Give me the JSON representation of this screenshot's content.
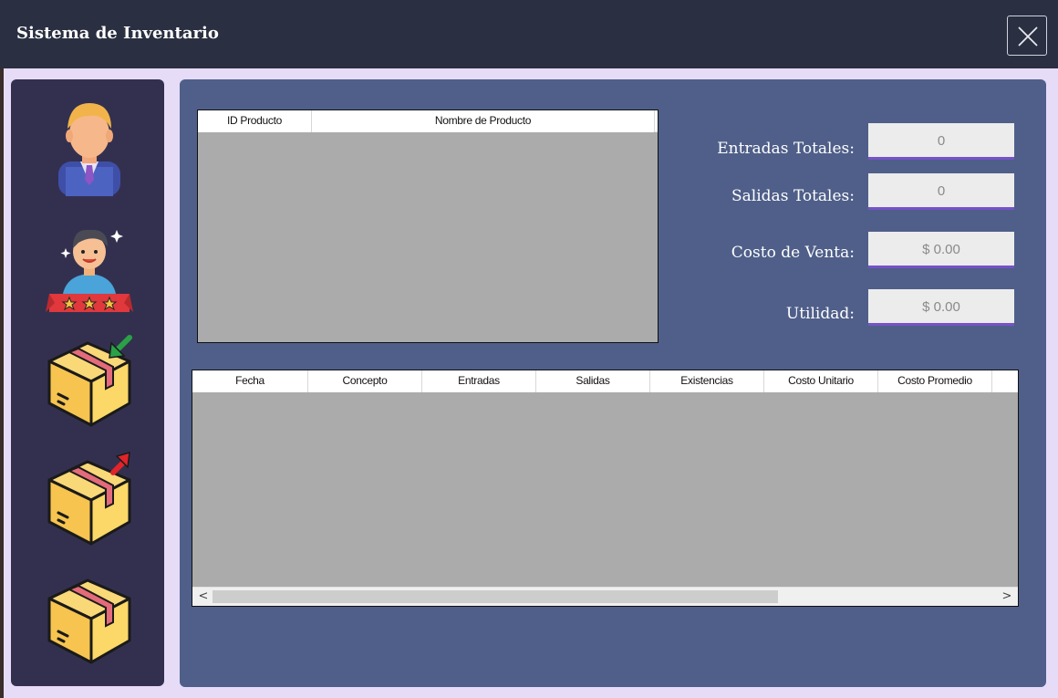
{
  "window": {
    "title": "Sistema de Inventario",
    "close_glyph": "✕"
  },
  "sidebar": {
    "items": [
      {
        "name": "user-avatar-icon"
      },
      {
        "name": "customer-rating-icon"
      },
      {
        "name": "box-inbound-icon"
      },
      {
        "name": "box-outbound-icon"
      },
      {
        "name": "box-inventory-icon"
      }
    ]
  },
  "products_table": {
    "columns": [
      "ID Producto",
      "Nombre de Producto"
    ],
    "rows": []
  },
  "summary": {
    "entradas_label": "Entradas Totales:",
    "entradas_value": "0",
    "salidas_label": "Salidas Totales:",
    "salidas_value": "0",
    "costo_label": "Costo de Venta:",
    "costo_value": "$ 0.00",
    "utilidad_label": "Utilidad:",
    "utilidad_value": "$ 0.00"
  },
  "movements_table": {
    "columns": [
      "Fecha",
      "Concepto",
      "Entradas",
      "Salidas",
      "Existencias",
      "Costo Unitario",
      "Costo Promedio"
    ],
    "rows": [],
    "scroll_left": "<",
    "scroll_right": ">"
  },
  "colors": {
    "titlebar": "#2a2f41",
    "sidebar": "#33304f",
    "panel": "#4f5f89",
    "accent": "#7553c8",
    "grid_bg": "#ababab"
  }
}
